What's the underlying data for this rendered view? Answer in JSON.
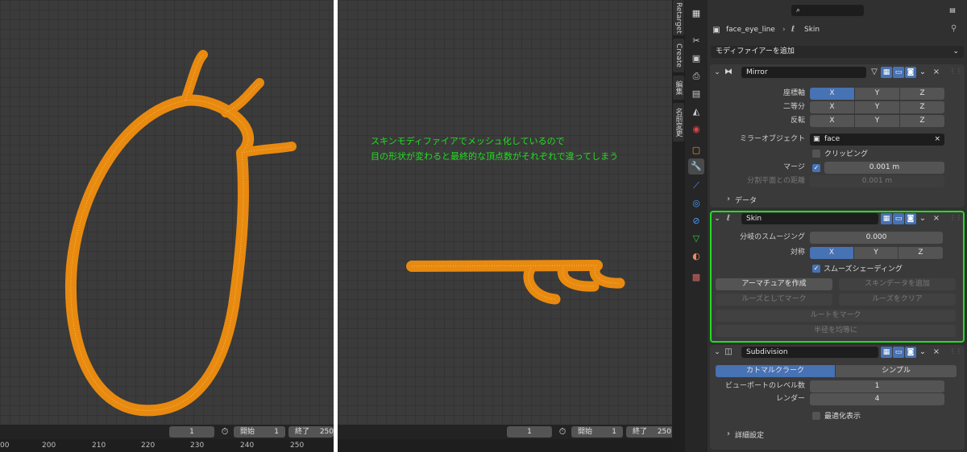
{
  "annotation": {
    "line1": "スキンモディファイアでメッシュ化しているので",
    "line2": "目の形状が変わると最終的な頂点数がそれぞれで違ってしまう",
    "color": "#22dd22"
  },
  "timeline_left": {
    "frame": "1",
    "start_label": "開始",
    "start": "1",
    "end_label": "終了",
    "end": "250",
    "ticks": [
      "00",
      "200",
      "210",
      "220",
      "230",
      "240",
      "250"
    ]
  },
  "timeline_right": {
    "frame": "1",
    "start_label": "開始",
    "start": "1",
    "end_label": "終了",
    "end": "250"
  },
  "side_tabs": [
    "Retarget",
    "Create",
    "編集",
    "名前変更"
  ],
  "properties": {
    "object_name": "face_eye_line",
    "modifier_name": "Skin",
    "add_modifier": "モディファイアーを追加",
    "mirror": {
      "name": "Mirror",
      "axis_label": "座標軸",
      "bisect_label": "二等分",
      "flip_label": "反転",
      "axes": [
        "X",
        "Y",
        "Z"
      ],
      "mirror_object_label": "ミラーオブジェクト",
      "mirror_object": "face",
      "clipping_label": "クリッピング",
      "merge_label": "マージ",
      "merge_value": "0.001 m",
      "bisect_distance_label": "分割平面との距離",
      "bisect_distance_value": "0.001 m",
      "data_label": "データ"
    },
    "skin": {
      "name": "Skin",
      "branch_smoothing_label": "分岐のスムージング",
      "branch_smoothing_value": "0.000",
      "symmetry_label": "対称",
      "axes": [
        "X",
        "Y",
        "Z"
      ],
      "smooth_shading_label": "スムーズシェーディング",
      "create_armature": "アーマチュアを作成",
      "add_skin_data": "スキンデータを追加",
      "mark_loose": "ルーズとしてマーク",
      "clear_loose": "ルーズをクリア",
      "mark_root": "ルートをマーク",
      "equalize_radii": "半径を均等に",
      "highlight_color": "#22dd22"
    },
    "subdivision": {
      "name": "Subdivision",
      "catmull_clark": "カトマルクラーク",
      "simple": "シンプル",
      "viewport_levels_label": "ビューポートのレベル数",
      "viewport_levels": "1",
      "render_label": "レンダー",
      "render_levels": "4",
      "optimal_display_label": "最適化表示",
      "advanced_label": "詳細設定"
    }
  },
  "colors": {
    "mesh": "#f5a623",
    "accent": "#4772b3"
  }
}
